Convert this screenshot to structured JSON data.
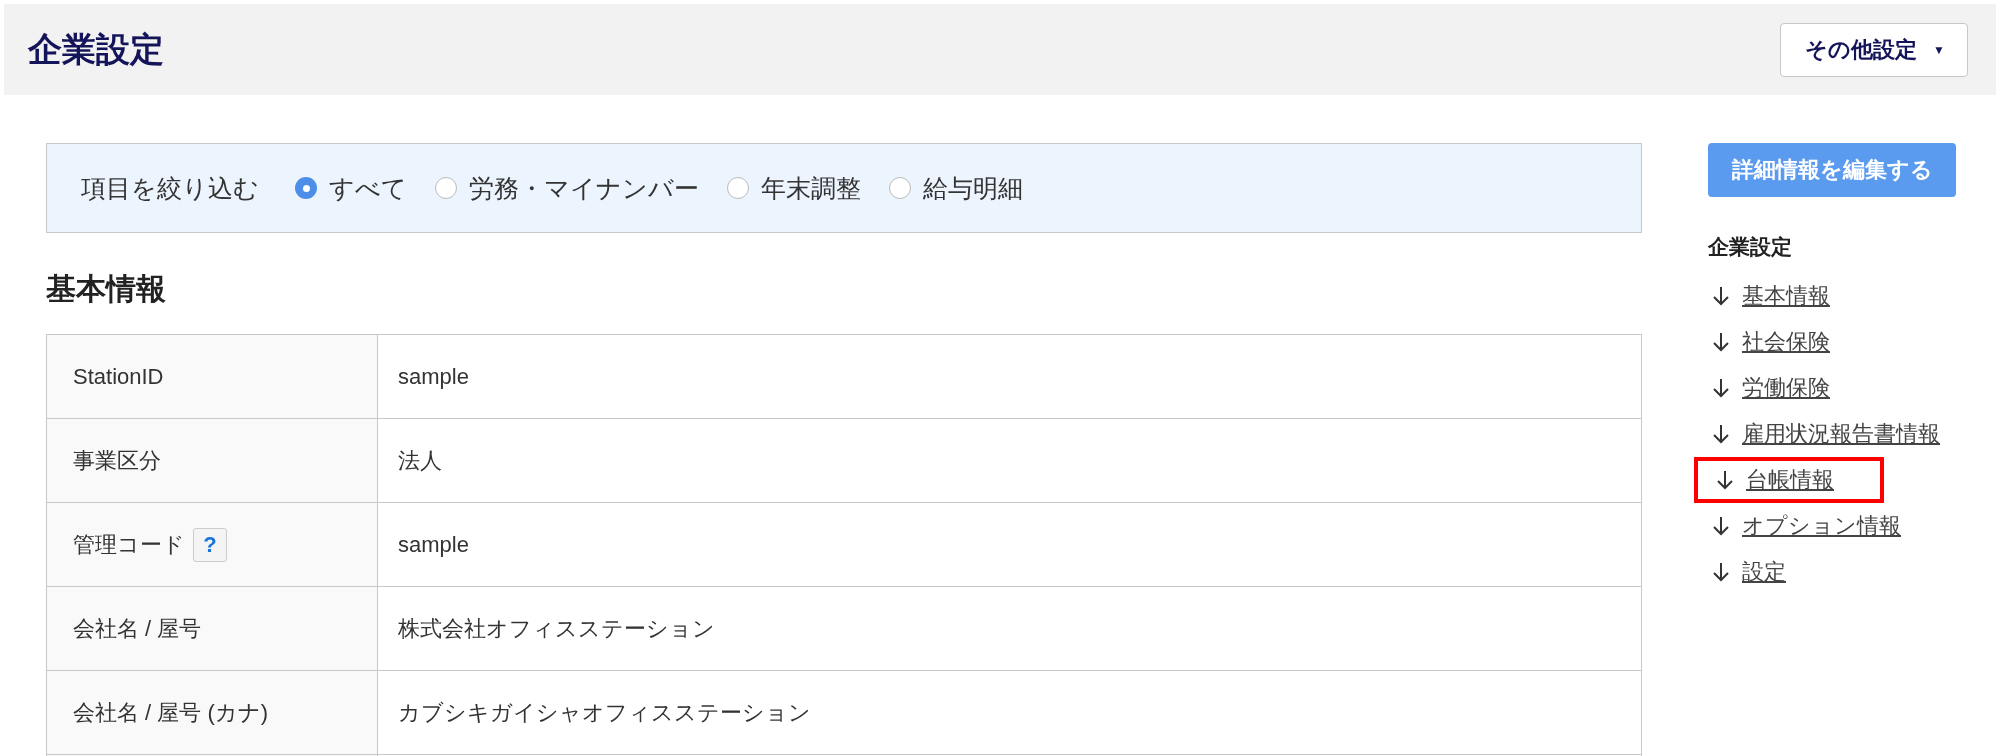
{
  "header": {
    "title": "企業設定",
    "menu_button": {
      "label": "その他設定",
      "caret": "▼"
    }
  },
  "filter": {
    "label": "項目を絞り込む",
    "options": [
      {
        "label": "すべて",
        "selected": true
      },
      {
        "label": "労務・マイナンバー",
        "selected": false
      },
      {
        "label": "年末調整",
        "selected": false
      },
      {
        "label": "給与明細",
        "selected": false
      }
    ]
  },
  "section_title": "基本情報",
  "table": {
    "rows": [
      {
        "label": "StationID",
        "value": "sample",
        "help": false
      },
      {
        "label": "事業区分",
        "value": "法人",
        "help": false
      },
      {
        "label": "管理コード",
        "value": "sample",
        "help": true,
        "help_mark": "?"
      },
      {
        "label": "会社名 / 屋号",
        "value": "株式会社オフィスステーション",
        "help": false
      },
      {
        "label": "会社名 / 屋号 (カナ)",
        "value": "カブシキガイシャオフィスステーション",
        "help": false
      }
    ]
  },
  "sidebar": {
    "edit_button": "詳細情報を編集する",
    "nav_title": "企業設定",
    "nav_items": [
      {
        "label": "基本情報",
        "highlighted": false
      },
      {
        "label": "社会保険",
        "highlighted": false
      },
      {
        "label": "労働保険",
        "highlighted": false
      },
      {
        "label": "雇用状況報告書情報",
        "highlighted": false
      },
      {
        "label": "台帳情報",
        "highlighted": true
      },
      {
        "label": "オプション情報",
        "highlighted": false
      },
      {
        "label": "設定",
        "highlighted": false
      }
    ]
  }
}
